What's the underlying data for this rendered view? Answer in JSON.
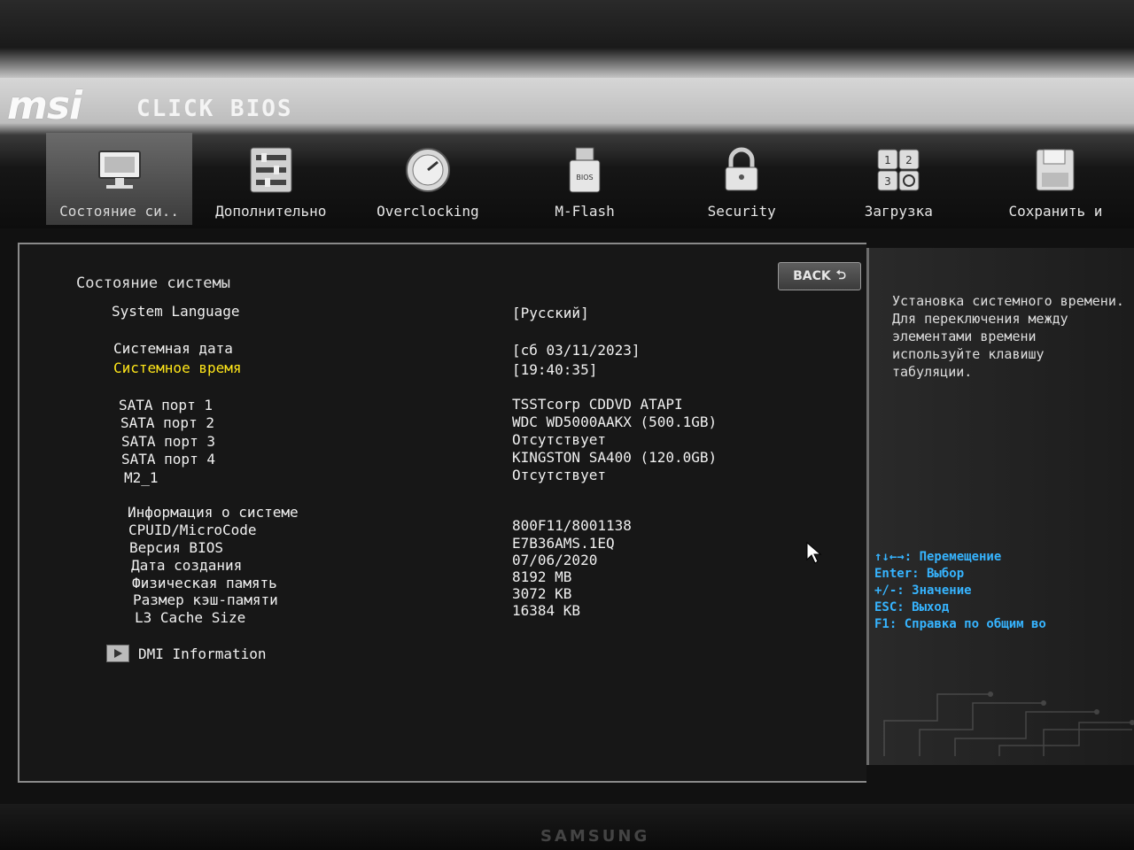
{
  "logo": {
    "brand": "msi",
    "product": "CLICK BIOS"
  },
  "tabs": [
    {
      "label": "Состояние си..",
      "icon": "monitor-icon",
      "active": true
    },
    {
      "label": "Дополнительно",
      "icon": "sliders-icon",
      "active": false
    },
    {
      "label": "Overclocking",
      "icon": "gauge-icon",
      "active": false
    },
    {
      "label": "M-Flash",
      "icon": "usb-drive-icon",
      "active": false
    },
    {
      "label": "Security",
      "icon": "padlock-icon",
      "active": false
    },
    {
      "label": "Загрузка",
      "icon": "boot-order-icon",
      "active": false
    },
    {
      "label": "Сохранить и",
      "icon": "floppy-disk-icon",
      "active": false
    }
  ],
  "back_button": {
    "label": "BACK"
  },
  "section_title": "Состояние системы",
  "system_language": {
    "label": "System Language",
    "value": "[Русский]"
  },
  "system_date": {
    "label": "Системная дата",
    "value": "[сб 03/11/2023]"
  },
  "system_time": {
    "label": "Системное время",
    "value": "[19:40:35]"
  },
  "sata": [
    {
      "label": "SATA порт 1",
      "value": "TSSTcorp CDDVD ATAPI"
    },
    {
      "label": "SATA порт 2",
      "value": "WDC WD5000AAKX (500.1GB)"
    },
    {
      "label": "SATA порт 3",
      "value": "Отсутствует"
    },
    {
      "label": "SATA порт 4",
      "value": "KINGSTON SA400 (120.0GB)"
    },
    {
      "label": "M2_1",
      "value": "Отсутствует"
    }
  ],
  "sysinfo": {
    "title": "Информация о системе",
    "items": [
      {
        "label": "CPUID/MicroCode",
        "value": "800F11/8001138"
      },
      {
        "label": "Версия BIOS",
        "value": "E7B36AMS.1EQ"
      },
      {
        "label": "Дата создания",
        "value": "07/06/2020"
      },
      {
        "label": "Физическая память",
        "value": "8192 MB"
      },
      {
        "label": "Размер кэш-памяти",
        "value": "3072 KB"
      },
      {
        "label": "L3 Cache Size",
        "value": "16384 KB"
      }
    ]
  },
  "dmi": {
    "label": "DMI Information"
  },
  "help": {
    "text": "Установка системного времени. Для переключения между элементами времени используйте клавишу табуляции.",
    "keys": [
      "↑↓←→: Перемещение",
      "Enter: Выбор",
      "+/-: Значение",
      "ESC: Выход",
      "F1: Справка по общим во"
    ]
  },
  "monitor": {
    "brand": "SAMSUNG"
  },
  "colors": {
    "highlight": "#ffe619",
    "help_keys": "#36b4ff",
    "background": "#171717"
  }
}
